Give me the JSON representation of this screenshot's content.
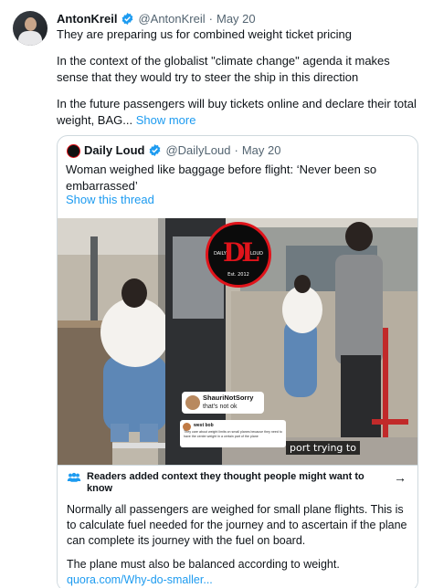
{
  "tweet": {
    "author_name": "AntonKreil",
    "author_handle": "@AntonKreil",
    "separator": "·",
    "date": "May 20",
    "paragraph_1": "They are preparing us for combined weight ticket pricing",
    "paragraph_2": "In the context of the globalist \"climate change\" agenda it makes sense that they would try to steer the ship in this direction",
    "paragraph_3": "In the future passengers will buy tickets online and declare their total weight, BAG...",
    "show_more": "Show more"
  },
  "quote": {
    "author_name": "Daily Loud",
    "author_handle": "@DailyLoud",
    "separator": "·",
    "date": "May 20",
    "text": "Woman weighed like baggage before flight: ‘Never been so embarrassed’",
    "show_thread": "Show this thread"
  },
  "video": {
    "logo_top_left": "DAILY",
    "logo_top_right": "LOUD",
    "logo_letters": "DL",
    "logo_est": "Est. 2012",
    "comment_1_user": "ShauriNotSorry",
    "comment_1_text": "that's not ok",
    "comment_2_user": "west bob",
    "comment_2_text": "They care about weight limits on small planes because they need to have the center weight in a certain part of the plane",
    "caption": "port trying to"
  },
  "community_notes": {
    "heading": "Readers added context they thought people might want to know",
    "note_paragraph_1": "Normally all passengers are weighed for small plane flights.  This is to calculate fuel needed for the journey and to ascertain if the plane can complete its journey with the fuel on board.",
    "note_paragraph_2": "The plane must also be balanced according to weight.",
    "source_link": "quora.com/Why-do-smaller..."
  },
  "colors": {
    "link_blue": "#1d9bf0",
    "verified_blue": "#1d9bf0",
    "muted_gray": "#536471",
    "logo_red": "#e0141b"
  }
}
